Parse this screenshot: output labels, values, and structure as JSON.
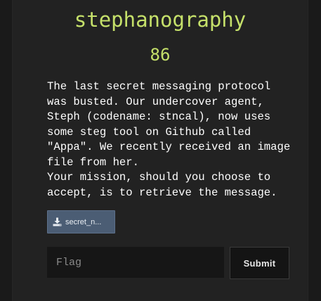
{
  "challenge": {
    "title": "stephanography",
    "points": "86",
    "description": [
      "The last secret messaging protocol was busted. Our undercover agent, Steph (codename: stncal), now uses some steg tool on Github called \"Appa\". We recently received an image file from her.",
      "Your mission, should you choose to accept, is to retrieve the message."
    ],
    "file": {
      "label": "secret_n...",
      "icon": "download-icon"
    }
  },
  "submission": {
    "flag_placeholder": "Flag",
    "flag_value": "",
    "submit_label": "Submit"
  },
  "colors": {
    "accent": "#c5e06a",
    "background": "#222222",
    "file_button": "#4b5d74"
  }
}
